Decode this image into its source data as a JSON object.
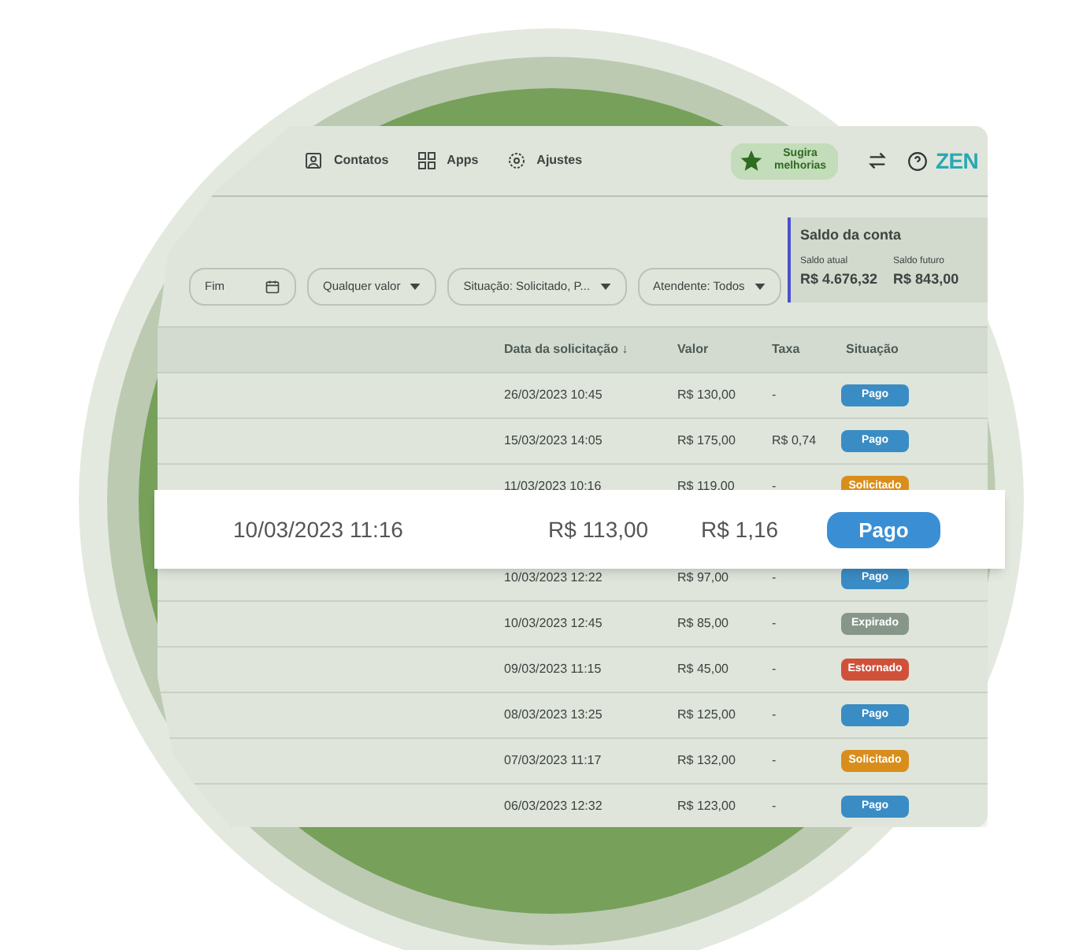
{
  "nav": {
    "items": [
      {
        "label": "Contatos"
      },
      {
        "label": "Apps"
      },
      {
        "label": "Ajustes"
      }
    ],
    "suggest_button": "Sugira melhorias",
    "logo": "ZEN"
  },
  "filters": [
    {
      "label": "Fim",
      "kind": "date"
    },
    {
      "label": "Qualquer valor",
      "kind": "select"
    },
    {
      "label": "Situação: Solicitado, P...",
      "kind": "select"
    },
    {
      "label": "Atendente: Todos",
      "kind": "select"
    }
  ],
  "balance": {
    "title": "Saldo da conta",
    "current_label": "Saldo atual",
    "current_value": "R$ 4.676,32",
    "future_label": "Saldo futuro",
    "future_value": "R$ 843,00"
  },
  "table": {
    "columns": [
      "Data da solicitação ↓",
      "Valor",
      "Taxa",
      "Situação"
    ],
    "rows": [
      {
        "date": "26/03/2023  10:45",
        "value": "R$ 130,00",
        "fee": "-",
        "status": "Pago",
        "color": "#3a8cc4"
      },
      {
        "date": "15/03/2023  14:05",
        "value": "R$ 175,00",
        "fee": "R$ 0,74",
        "status": "Pago",
        "color": "#3a8cc4"
      },
      {
        "date": "11/03/2023  10:16",
        "value": "R$ 119,00",
        "fee": "-",
        "status": "Solicitado",
        "color": "#d98e1c"
      },
      {
        "date": "10/03/2023  12:22",
        "value": "R$ 97,00",
        "fee": "-",
        "status": "Pago",
        "color": "#3a8cc4"
      },
      {
        "date": "10/03/2023  12:45",
        "value": "R$ 85,00",
        "fee": "-",
        "status": "Expirado",
        "color": "#86978a"
      },
      {
        "date": "09/03/2023  11:15",
        "value": "R$ 45,00",
        "fee": "-",
        "status": "Estornado",
        "color": "#d0513a"
      },
      {
        "date": "08/03/2023  13:25",
        "value": "R$ 125,00",
        "fee": "-",
        "status": "Pago",
        "color": "#3a8cc4"
      },
      {
        "date": "07/03/2023  11:17",
        "value": "R$ 132,00",
        "fee": "-",
        "status": "Solicitado",
        "color": "#d98e1c"
      },
      {
        "date": "06/03/2023  12:32",
        "value": "R$ 123,00",
        "fee": "-",
        "status": "Pago",
        "color": "#3a8cc4"
      }
    ],
    "highlighted_row": {
      "date": "10/03/2023  11:16",
      "value": "R$ 113,00",
      "fee": "R$ 1,16",
      "status": "Pago"
    }
  }
}
